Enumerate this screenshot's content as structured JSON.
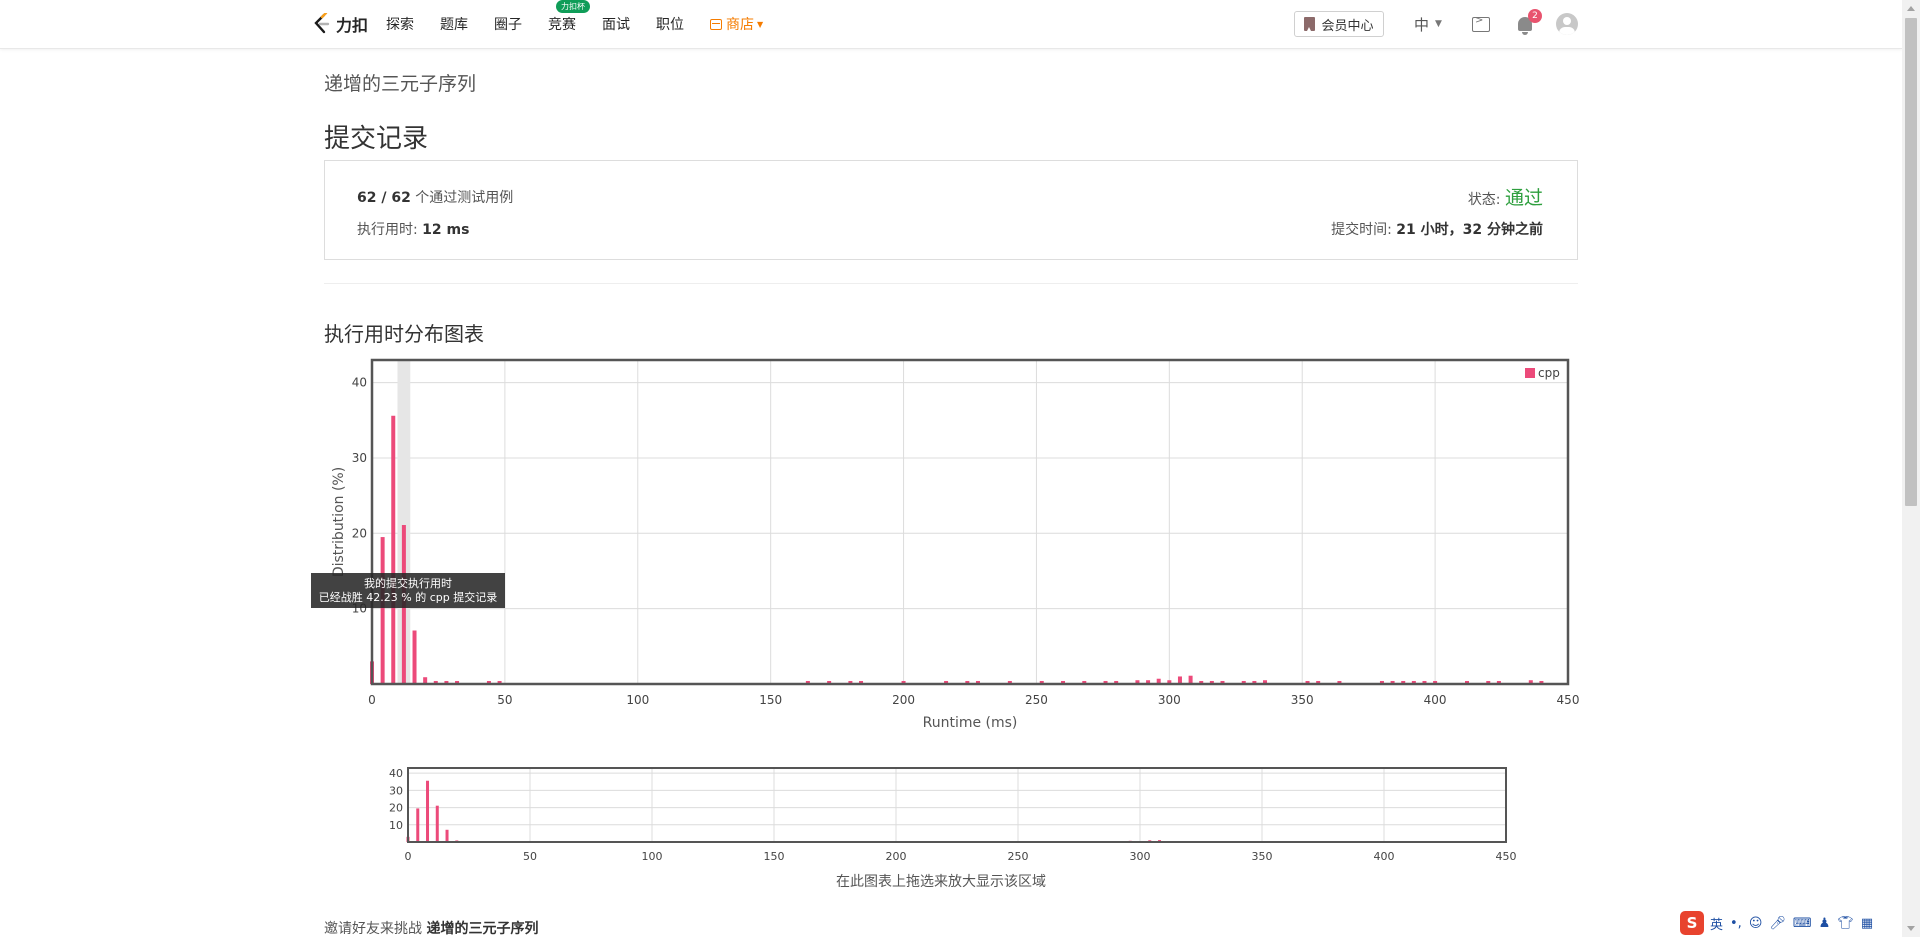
{
  "nav": {
    "logo_text": "力扣",
    "items": [
      "探索",
      "题库",
      "圈子",
      "竞赛",
      "面试",
      "职位"
    ],
    "contest_badge": "力扣杯",
    "store_label": "商店",
    "member_center": "会员中心",
    "language": "中",
    "notification_count": "2"
  },
  "problem_title": "递增的三元子序列",
  "page_title": "提交记录",
  "result": {
    "passed": "62 / 62",
    "passed_suffix": "个通过测试用例",
    "status_label": "状态:",
    "status_value": "通过",
    "runtime_label": "执行用时:",
    "runtime_value": "12 ms",
    "submit_time_label": "提交时间:",
    "submit_time_value": "21 小时，32 分钟之前"
  },
  "chart_heading": "执行用时分布图表",
  "chart_data": {
    "type": "bar",
    "xlabel": "Runtime (ms)",
    "ylabel": "Distribution (%)",
    "xlim": [
      0,
      450
    ],
    "ylim": [
      0,
      43
    ],
    "x_ticks": [
      0,
      50,
      100,
      150,
      200,
      250,
      300,
      350,
      400,
      450
    ],
    "y_ticks": [
      10,
      20,
      30,
      40
    ],
    "legend": "cpp",
    "legend_position": "top-right",
    "grid": true,
    "color": "#ec4a7a",
    "highlight_x": 12,
    "x": [
      0,
      4,
      8,
      12,
      16,
      20,
      24,
      28,
      32,
      44,
      48,
      164,
      172,
      180,
      184,
      200,
      216,
      224,
      228,
      240,
      252,
      260,
      268,
      276,
      280,
      288,
      292,
      296,
      300,
      304,
      308,
      312,
      316,
      320,
      328,
      332,
      336,
      352,
      356,
      364,
      380,
      384,
      388,
      392,
      396,
      400,
      412,
      420,
      424,
      436,
      440
    ],
    "values": [
      3,
      19.5,
      35.6,
      21.1,
      7.1,
      0.9,
      0.4,
      0.4,
      0.4,
      0.4,
      0.4,
      0.4,
      0.4,
      0.4,
      0.4,
      0.4,
      0.4,
      0.4,
      0.4,
      0.4,
      0.4,
      0.4,
      0.4,
      0.4,
      0.4,
      0.5,
      0.5,
      0.7,
      0.5,
      1.0,
      1.1,
      0.4,
      0.4,
      0.4,
      0.4,
      0.4,
      0.5,
      0.4,
      0.4,
      0.4,
      0.4,
      0.4,
      0.4,
      0.4,
      0.4,
      0.4,
      0.4,
      0.4,
      0.4,
      0.5,
      0.4
    ]
  },
  "mini_chart": {
    "y_ticks": [
      10,
      20,
      30,
      40
    ],
    "x_ticks": [
      0,
      50,
      100,
      150,
      200,
      250,
      300,
      350,
      400,
      450
    ],
    "hint": "在此图表上拖选来放大显示该区域"
  },
  "tooltip": {
    "line1": "我的提交执行用时",
    "line2": "已经战胜 42.23 % 的 cpp 提交记录"
  },
  "invite": {
    "prefix": "邀请好友来挑战",
    "title": "递增的三元子序列"
  },
  "ime": {
    "logo": "S",
    "mode": "英"
  }
}
